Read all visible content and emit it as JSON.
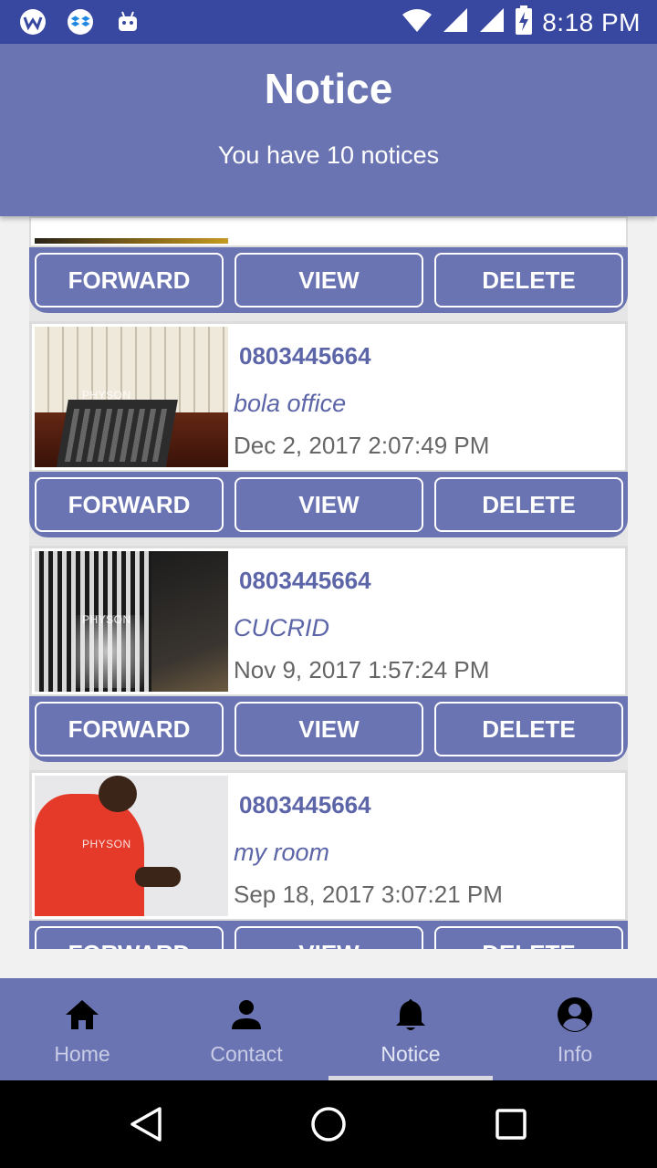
{
  "status_bar": {
    "time": "8:18 PM",
    "left_icons": [
      "wps-icon",
      "dropbox-icon",
      "android-icon"
    ],
    "right_icons": [
      "wifi-icon",
      "signal-icon",
      "signal-icon",
      "battery-charging-icon"
    ]
  },
  "header": {
    "title": "Notice",
    "subtitle": "You have 10 notices"
  },
  "buttons": {
    "forward": "FORWARD",
    "view": "VIEW",
    "delete": "DELETE"
  },
  "notices": [
    {
      "phone": "0803445664",
      "description": "bola office",
      "date": "Dec 2, 2017 2:07:49 PM",
      "watermark": "PHYSON"
    },
    {
      "phone": "0803445664",
      "description": "CUCRID",
      "date": "Nov 9, 2017 1:57:24 PM",
      "watermark": "PHYSON"
    },
    {
      "phone": "0803445664",
      "description": "my room",
      "date": "Sep 18, 2017 3:07:21 PM",
      "watermark": "PHYSON"
    }
  ],
  "bottom_nav": {
    "active": "Notice",
    "items": [
      {
        "label": "Home",
        "icon": "home-icon"
      },
      {
        "label": "Contact",
        "icon": "person-icon"
      },
      {
        "label": "Notice",
        "icon": "bell-icon"
      },
      {
        "label": "Info",
        "icon": "account-circle-icon"
      }
    ]
  },
  "system_nav": [
    "back-icon",
    "home-circle-icon",
    "recents-icon"
  ],
  "colors": {
    "status_bar": "#3848a0",
    "primary": "#6b74b2",
    "accent_text": "#5c65a8"
  }
}
